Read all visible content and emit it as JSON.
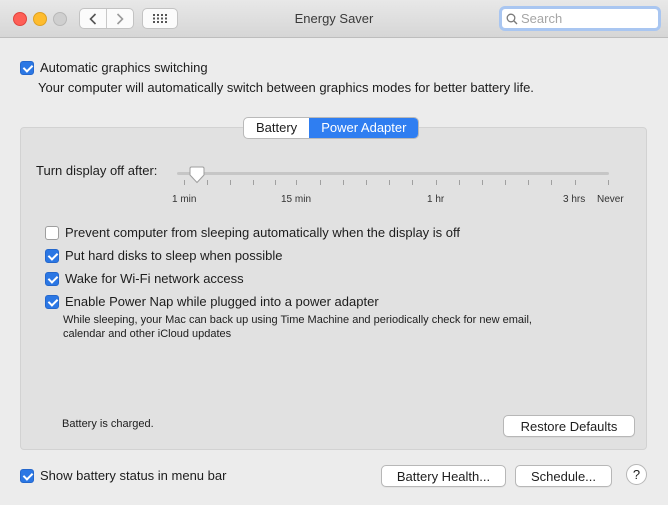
{
  "window": {
    "title": "Energy Saver"
  },
  "search": {
    "placeholder": "Search"
  },
  "graphics": {
    "label": "Automatic graphics switching",
    "checked": true,
    "description": "Your computer will automatically switch between graphics modes for better battery life."
  },
  "tabs": [
    {
      "label": "Battery",
      "active": false
    },
    {
      "label": "Power Adapter",
      "active": true
    }
  ],
  "display_off": {
    "label": "Turn display off after:",
    "value": "1 min",
    "ticks": [
      "1 min",
      "15 min",
      "1 hr",
      "3 hrs",
      "Never"
    ]
  },
  "options": [
    {
      "label": "Prevent computer from sleeping automatically when the display is off",
      "checked": false
    },
    {
      "label": "Put hard disks to sleep when possible",
      "checked": true
    },
    {
      "label": "Wake for Wi-Fi network access",
      "checked": true
    },
    {
      "label": "Enable Power Nap while plugged into a power adapter",
      "checked": true
    }
  ],
  "power_nap_description": {
    "line1": "While sleeping, your Mac can back up using Time Machine and periodically check for new email,",
    "line2": "calendar and other iCloud updates"
  },
  "status": "Battery is charged.",
  "buttons": {
    "restore": "Restore Defaults",
    "battery_health": "Battery Health...",
    "schedule": "Schedule...",
    "help": "?"
  },
  "show_battery": {
    "label": "Show battery status in menu bar",
    "checked": true
  },
  "icons": {
    "back": "chevron-left-icon",
    "forward": "chevron-right-icon",
    "grid": "grid-icon",
    "search": "search-icon"
  }
}
